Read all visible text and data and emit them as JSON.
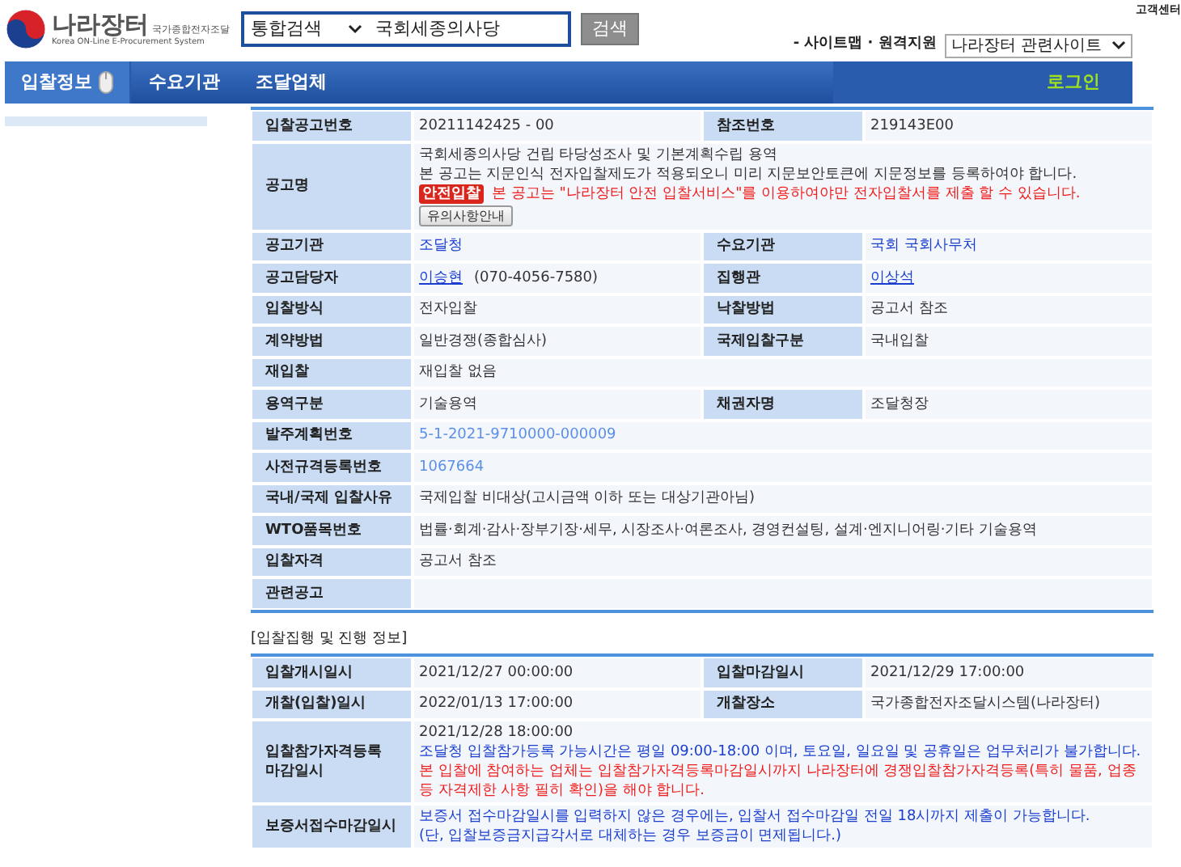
{
  "header": {
    "logo_title": "나라장터",
    "logo_subtitle": "국가종합전자조달",
    "logo_english": "Korea ON-Line E-Procurement System",
    "search_category": "통합검색",
    "search_value": "국회세종의사당",
    "search_button": "검색",
    "top_link": "고객센터",
    "links": [
      "- 사이트맵",
      "· 원격지원"
    ],
    "related_select": "나라장터 관련사이트"
  },
  "nav": {
    "items": [
      {
        "label": "입찰정보",
        "selected": true
      },
      {
        "label": "수요기관",
        "selected": false
      },
      {
        "label": "조달업체",
        "selected": false
      }
    ],
    "login": "로그인"
  },
  "notice_table": {
    "rows": [
      {
        "cells": [
          {
            "label": "입찰공고번호",
            "value": [
              [
                {
                  "kind": "text",
                  "text": "20211142425 - 00"
                }
              ]
            ]
          },
          {
            "label": "참조번호",
            "value": [
              [
                {
                  "kind": "text",
                  "text": "219143E00"
                }
              ]
            ]
          }
        ]
      },
      {
        "cells": [
          {
            "label": "공고명",
            "value": [
              [
                {
                  "kind": "text",
                  "text": "국회세종의사당 건립 타당성조사 및 기본계획수립 용역"
                }
              ],
              [
                {
                  "kind": "text",
                  "text": "본 공고는 지문인식 전자입찰제도가 적용되오니 미리 지문보안토큰에 지문정보를 등록하여야 합니다."
                }
              ],
              [
                {
                  "kind": "badge",
                  "text": "안전입찰"
                },
                {
                  "kind": "red",
                  "text": "본 공고는 \"나라장터 안전 입찰서비스\"를 이용하여야만 전자입찰서를 제출 할 수 있습니다."
                }
              ],
              [
                {
                  "kind": "button",
                  "text": "유의사항안내"
                }
              ]
            ]
          }
        ]
      },
      {
        "cells": [
          {
            "label": "공고기관",
            "value": [
              [
                {
                  "kind": "blue",
                  "text": "조달청"
                }
              ]
            ]
          },
          {
            "label": "수요기관",
            "value": [
              [
                {
                  "kind": "blue",
                  "text": "국회 국회사무처"
                }
              ]
            ]
          }
        ]
      },
      {
        "cells": [
          {
            "label": "공고담당자",
            "value": [
              [
                {
                  "kind": "link",
                  "text": "이승현"
                },
                {
                  "kind": "text",
                  "text": "(070-4056-7580)"
                }
              ]
            ]
          },
          {
            "label": "집행관",
            "value": [
              [
                {
                  "kind": "link",
                  "text": "이상석"
                }
              ]
            ]
          }
        ]
      },
      {
        "cells": [
          {
            "label": "입찰방식",
            "value": [
              [
                {
                  "kind": "text",
                  "text": "전자입찰"
                }
              ]
            ]
          },
          {
            "label": "낙찰방법",
            "value": [
              [
                {
                  "kind": "text",
                  "text": "공고서 참조"
                }
              ]
            ]
          }
        ]
      },
      {
        "cells": [
          {
            "label": "계약방법",
            "value": [
              [
                {
                  "kind": "text",
                  "text": "일반경쟁(종합심사)"
                }
              ]
            ]
          },
          {
            "label": "국제입찰구분",
            "value": [
              [
                {
                  "kind": "text",
                  "text": "국내입찰"
                }
              ]
            ]
          }
        ]
      },
      {
        "cells": [
          {
            "label": "재입찰",
            "value": [
              [
                {
                  "kind": "text",
                  "text": "재입찰 없음"
                }
              ]
            ]
          }
        ]
      },
      {
        "cells": [
          {
            "label": "용역구분",
            "value": [
              [
                {
                  "kind": "text",
                  "text": "기술용역"
                }
              ]
            ]
          },
          {
            "label": "채권자명",
            "value": [
              [
                {
                  "kind": "text",
                  "text": "조달청장"
                }
              ]
            ]
          }
        ]
      },
      {
        "cells": [
          {
            "label": "발주계획번호",
            "value": [
              [
                {
                  "kind": "lightblue",
                  "text": "5-1-2021-9710000-000009"
                }
              ]
            ]
          }
        ]
      },
      {
        "cells": [
          {
            "label": "사전규격등록번호",
            "value": [
              [
                {
                  "kind": "lightblue",
                  "text": "1067664"
                }
              ]
            ]
          }
        ]
      },
      {
        "cells": [
          {
            "label": "국내/국제 입찰사유",
            "value": [
              [
                {
                  "kind": "text",
                  "text": "국제입찰 비대상(고시금액 이하 또는 대상기관아님)"
                }
              ]
            ]
          }
        ]
      },
      {
        "cells": [
          {
            "label": "WTO품목번호",
            "value": [
              [
                {
                  "kind": "text",
                  "text": "법률·회계·감사·장부기장·세무, 시장조사·여론조사, 경영컨설팅, 설계·엔지니어링·기타 기술용역"
                }
              ]
            ]
          }
        ]
      },
      {
        "cells": [
          {
            "label": "입찰자격",
            "value": [
              [
                {
                  "kind": "text",
                  "text": "공고서 참조"
                }
              ]
            ]
          }
        ]
      },
      {
        "cells": [
          {
            "label": "관련공고"
          }
        ]
      }
    ]
  },
  "progress_section": {
    "title": "[입찰집행 및 진행 정보]",
    "rows": [
      {
        "cells": [
          {
            "label": "입찰개시일시",
            "value": [
              [
                {
                  "kind": "text",
                  "text": "2021/12/27 00:00:00"
                }
              ]
            ]
          },
          {
            "label": "입찰마감일시",
            "value": [
              [
                {
                  "kind": "text",
                  "text": "2021/12/29 17:00:00"
                }
              ]
            ]
          }
        ]
      },
      {
        "cells": [
          {
            "label": "개찰(입찰)일시",
            "value": [
              [
                {
                  "kind": "text",
                  "text": "2022/01/13 17:00:00"
                }
              ]
            ]
          },
          {
            "label": "개찰장소",
            "value": [
              [
                {
                  "kind": "text",
                  "text": "국가종합전자조달시스템(나라장터)"
                }
              ]
            ]
          }
        ]
      },
      {
        "cells": [
          {
            "label": "입찰참가자격등록\n마감일시",
            "value": [
              [
                {
                  "kind": "text",
                  "text": "2021/12/28 18:00:00"
                }
              ],
              [
                {
                  "kind": "blue",
                  "text": "조달청 입찰참가등록 가능시간은 평일 09:00-18:00 이며, 토요일, 일요일 및 공휴일은 업무처리가 불가합니다."
                }
              ],
              [
                {
                  "kind": "red",
                  "text": "본 입찰에 참여하는 업체는 입찰참가자격등록마감일시까지 나라장터에 경쟁입찰참가자격등록(특히 물품, 업종 등 자격제한 사항 필히 확인)을 해야 합니다."
                }
              ]
            ]
          }
        ]
      },
      {
        "cells": [
          {
            "label": "보증서접수마감일시",
            "value": [
              [
                {
                  "kind": "blue",
                  "text": "보증서 접수마감일시를 입력하지 않은 경우에는, 입찰서 접수마감일 전일 18시까지 제출이 가능합니다."
                }
              ],
              [
                {
                  "kind": "blue",
                  "text": "(단, 입찰보증금지급각서로 대체하는 경우 보증금이 면제됩니다.)"
                }
              ]
            ]
          }
        ]
      }
    ]
  }
}
